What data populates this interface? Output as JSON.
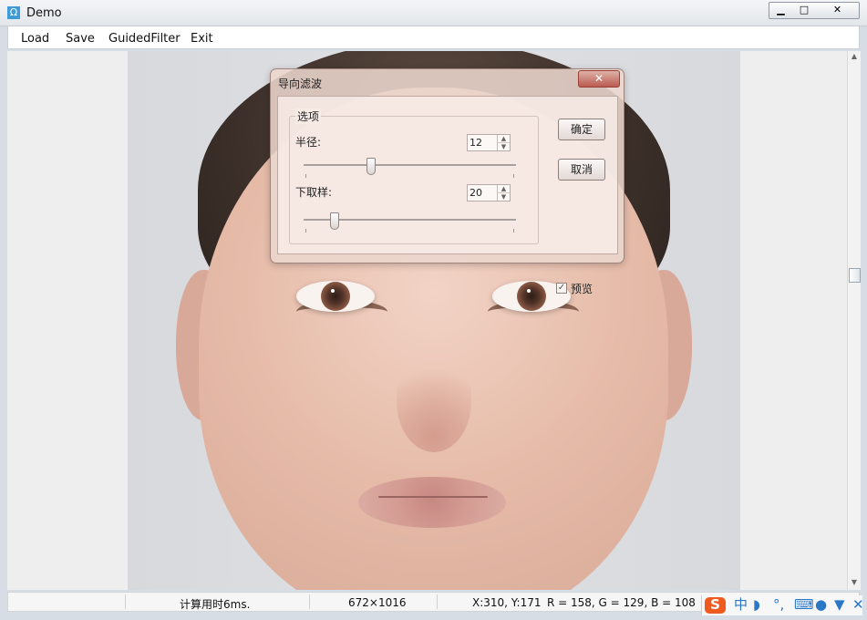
{
  "window": {
    "title": "Demo",
    "controls": {
      "minimize": "▁",
      "maximize": "□",
      "close": "✕"
    }
  },
  "menu": {
    "items": [
      "Load",
      "Save",
      "GuidedFilter",
      "Exit"
    ]
  },
  "dialog": {
    "title": "导向滤波",
    "group_label": "选项",
    "radius": {
      "label": "半径:",
      "value": "12",
      "slider_position": 0.31
    },
    "downsample": {
      "label": "下取样:",
      "value": "20",
      "slider_position": 0.13
    },
    "buttons": {
      "ok": "确定",
      "cancel": "取消"
    },
    "preview": {
      "label": "预览",
      "checked": true
    },
    "close_label": "✕"
  },
  "status": {
    "compute_time": "计算用时6ms.",
    "image_size": "672×1016",
    "coords": "X:310, Y:171",
    "rgb": "R = 158, G = 129, B = 108"
  },
  "scrollbar": {
    "up": "▲",
    "down": "▼"
  },
  "tray": {
    "sogou": "S",
    "chinese": "中",
    "moon": "◗",
    "punct": "°,",
    "keyboard": "⌨",
    "user": "●",
    "shirt": "▼",
    "tools": "✕"
  }
}
